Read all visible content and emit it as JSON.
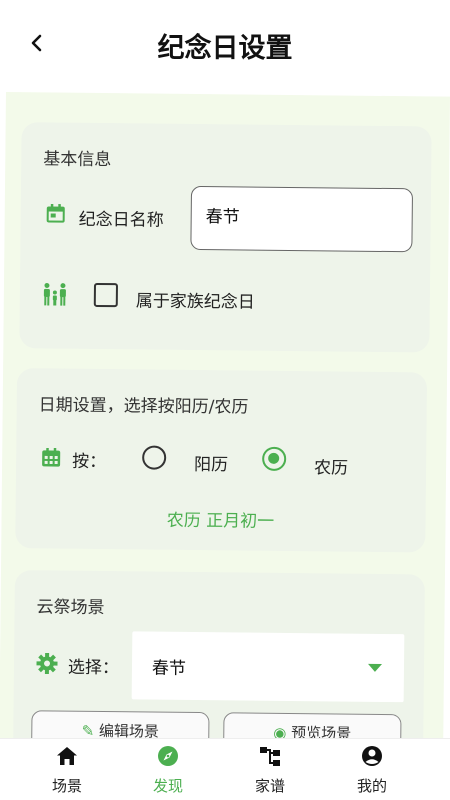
{
  "header": {
    "title": "纪念日设置",
    "back_icon": "chevron-left-icon"
  },
  "basic_info": {
    "section_title": "基本信息",
    "name_label": "纪念日名称",
    "name_value": "春节",
    "family_label": "属于家族纪念日",
    "family_checked": false
  },
  "date_settings": {
    "section_title": "日期设置，选择按阳历/农历",
    "by_label": "按：",
    "options": [
      {
        "label": "阳历",
        "selected": false
      },
      {
        "label": "农历",
        "selected": true
      }
    ],
    "date_display": "农历 正月初一"
  },
  "cloud_scene": {
    "section_title": "云祭场景",
    "select_label": "选择：",
    "select_value": "春节",
    "buttons": [
      {
        "label": "编辑场景",
        "icon": "edit-icon"
      },
      {
        "label": "预览场景",
        "icon": "eye-icon"
      }
    ]
  },
  "bottom_nav": {
    "items": [
      {
        "label": "场景",
        "icon": "home-icon",
        "active": false
      },
      {
        "label": "发现",
        "icon": "compass-icon",
        "active": true
      },
      {
        "label": "家谱",
        "icon": "tree-icon",
        "active": false
      },
      {
        "label": "我的",
        "icon": "user-icon",
        "active": false
      }
    ]
  },
  "colors": {
    "accent": "#4caf50",
    "content_bg": "#f3faea",
    "card_bg": "#eef4ea"
  }
}
